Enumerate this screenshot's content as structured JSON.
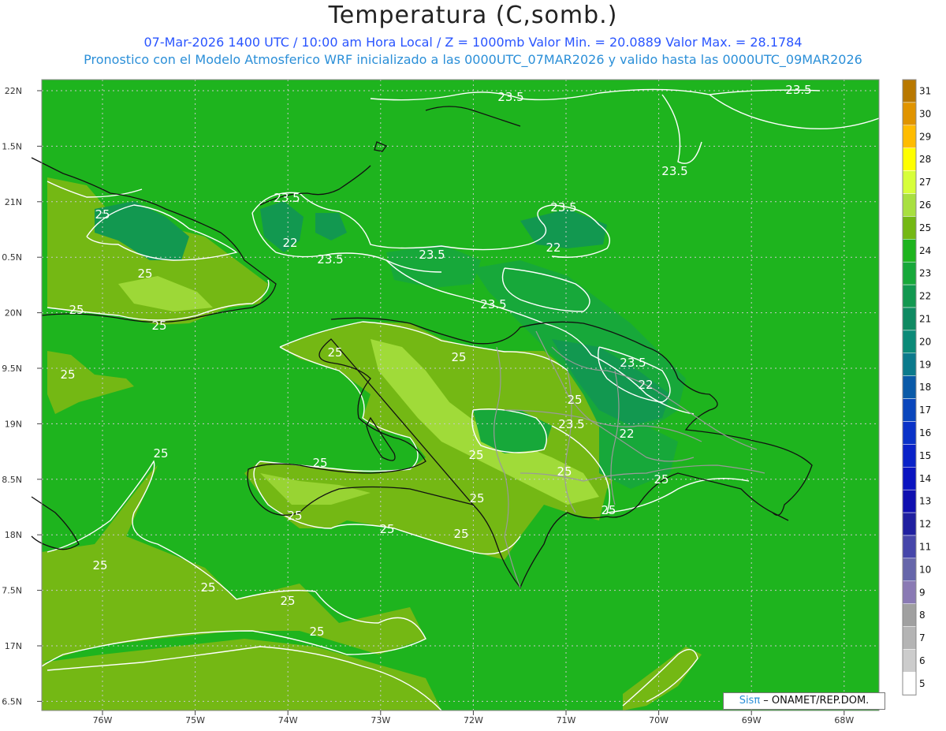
{
  "title": "Temperatura (C,somb.)",
  "subtitle1": "07-Mar-2026 1400 UTC / 10:00 am Hora Local / Z = 1000mb   Valor Min. = 20.0889  Valor Max. = 28.1784",
  "subtitle2": "Pronostico con el Modelo Atmosferico WRF inicializado a las 0000UTC_07MAR2026 y valido hasta las  0000UTC_09MAR2026",
  "credit": {
    "logo": "Sisπ",
    "text": " – ONAMET/REP.DOM."
  },
  "lat_labels": [
    "22N",
    "1.5N",
    "21N",
    "0.5N",
    "20N",
    "9.5N",
    "19N",
    "8.5N",
    "18N",
    "7.5N",
    "17N",
    "6.5N"
  ],
  "lon_labels": [
    "76W",
    "75W",
    "74W",
    "73W",
    "72W",
    "71W",
    "70W",
    "69W",
    "68W"
  ],
  "colorbar": {
    "labels": [
      "31",
      "30",
      "29",
      "28",
      "27",
      "26",
      "25",
      "24",
      "23",
      "22",
      "21",
      "20",
      "19",
      "18",
      "17",
      "16",
      "15",
      "14",
      "13",
      "12",
      "11",
      "10",
      "9",
      "8",
      "7",
      "6",
      "5"
    ],
    "colors": [
      "#b87800",
      "#e09400",
      "#ffbc00",
      "#ffff00",
      "#d7ff3a",
      "#a8e040",
      "#74b814",
      "#1eb41e",
      "#17a83a",
      "#129850",
      "#0f8a62",
      "#0b8a78",
      "#0b7a8c",
      "#0a5aa8",
      "#0a46bc",
      "#0a32c8",
      "#0a22c8",
      "#0a14c0",
      "#1010b0",
      "#2020a0",
      "#4646aa",
      "#6666aa",
      "#8a7ab4",
      "#a0a0a0",
      "#b4b4b4",
      "#cccccc",
      "#ffffff"
    ]
  },
  "contour_labels": [
    "23.5",
    "23.5",
    "23.5",
    "23.5",
    "23.5",
    "23.5",
    "23.5",
    "23.5",
    "23.5",
    "23.5",
    "22",
    "22",
    "22",
    "22",
    "25",
    "25",
    "25",
    "25",
    "25",
    "25",
    "25",
    "25",
    "25",
    "25",
    "25",
    "25",
    "25",
    "25",
    "25",
    "25",
    "25",
    "25",
    "25",
    "25",
    "25",
    "25"
  ]
}
